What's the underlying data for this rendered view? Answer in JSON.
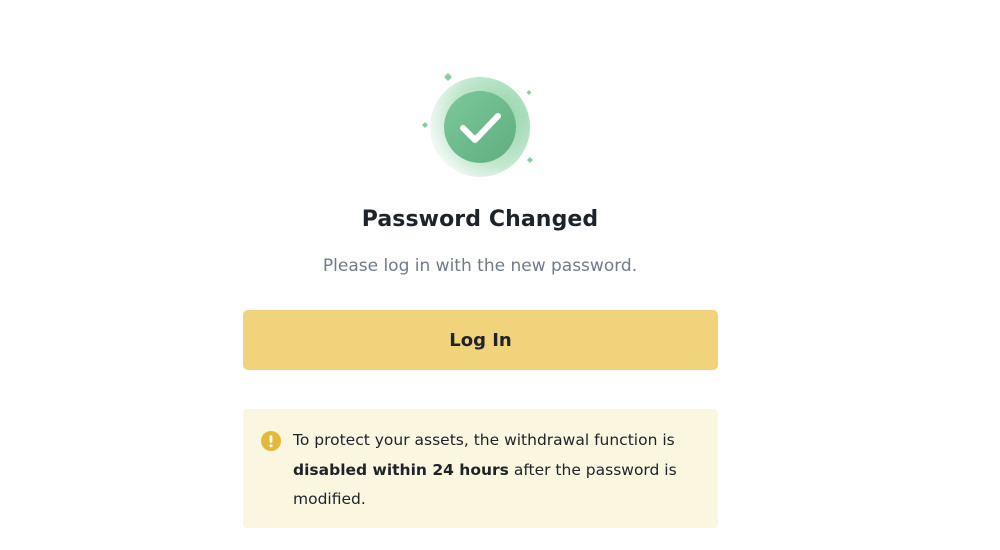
{
  "status": {
    "icon": "check-circle-icon",
    "title": "Password Changed",
    "subtitle": "Please log in with the new password."
  },
  "actions": {
    "login_label": "Log In"
  },
  "notice": {
    "icon": "exclamation-circle-icon",
    "text_before": "To protect your assets, the withdrawal function is ",
    "text_bold": "disabled within 24 hours",
    "text_after": " after the password is modified."
  },
  "colors": {
    "accent": "#F0D37A",
    "success": "#6FBF8E",
    "notice_background": "#FBF6DF",
    "notice_icon": "#E2B93B",
    "text_primary": "#1E2329",
    "text_secondary": "#707A8A"
  }
}
